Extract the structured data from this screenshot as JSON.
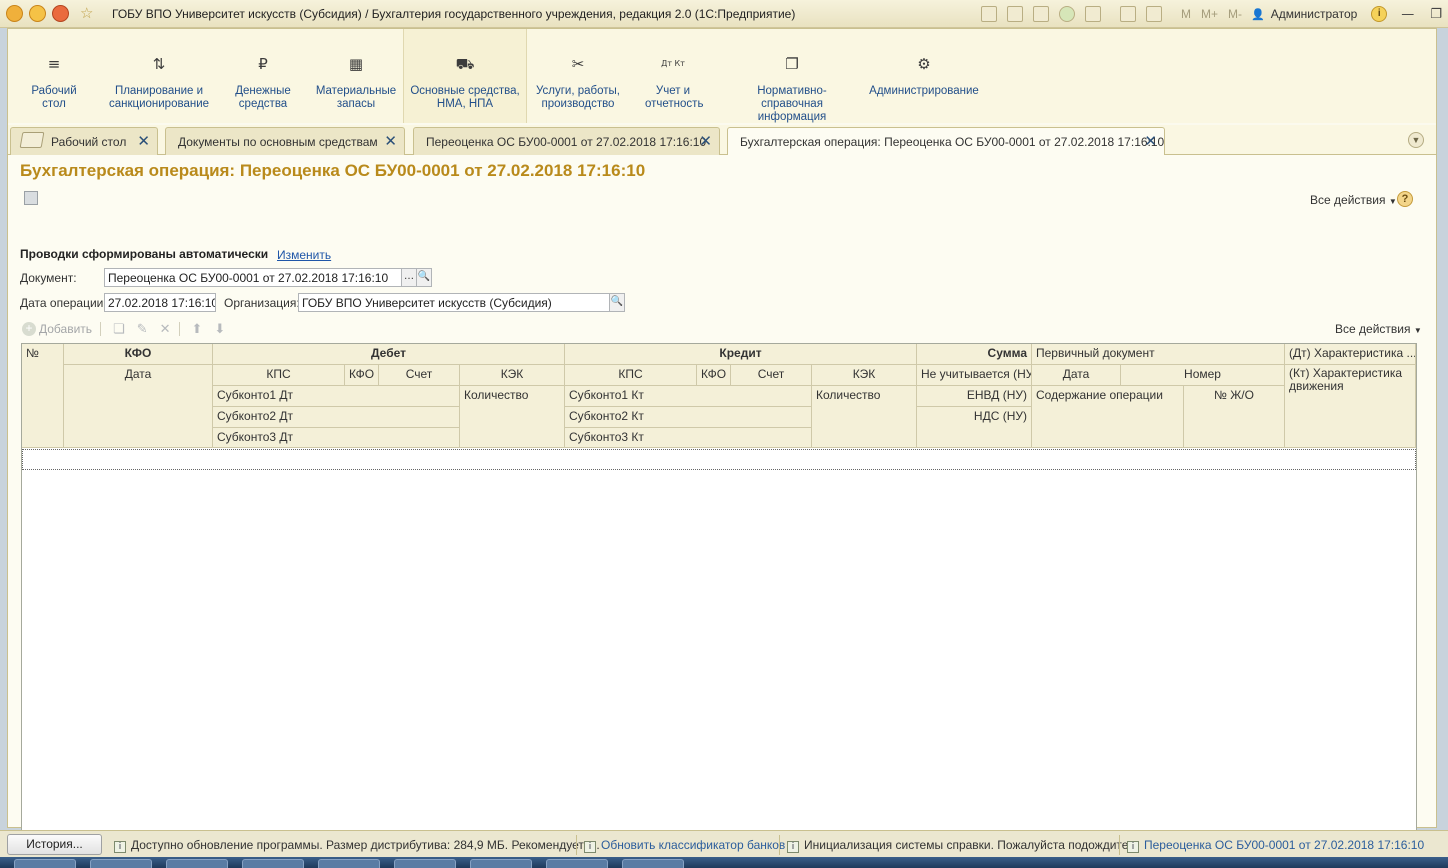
{
  "window": {
    "title": "ГОБУ ВПО Университет искусств (Субсидия) / Бухгалтерия государственного учреждения, редакция 2.0  (1С:Предприятие)",
    "m_buttons": [
      "M",
      "M+",
      "M-"
    ],
    "user": "Администратор"
  },
  "sections": [
    {
      "label": "Рабочий стол",
      "icon": "≡"
    },
    {
      "label": "Планирование и санкционирование",
      "icon": "⇅"
    },
    {
      "label": "Денежные средства",
      "icon": "₽"
    },
    {
      "label": "Материальные запасы",
      "icon": "▦"
    },
    {
      "label": "Основные средства, НМА, НПА",
      "icon": "⛟"
    },
    {
      "label": "Услуги, работы, производство",
      "icon": "✂"
    },
    {
      "label": "Учет и отчетность",
      "icon": "Дт Кт"
    },
    {
      "label": "Нормативно-справочная информация",
      "icon": "❐"
    },
    {
      "label": "Администрирование",
      "icon": "⚙"
    }
  ],
  "tabs": [
    {
      "label": "Рабочий стол"
    },
    {
      "label": "Документы по основным средствам"
    },
    {
      "label": "Переоценка ОС БУ00-0001 от 27.02.2018 17:16:10"
    },
    {
      "label": "Бухгалтерская операция: Переоценка ОС БУ00-0001 от 27.02.2018 17:16:10"
    }
  ],
  "form": {
    "title": "Бухгалтерская операция: Переоценка ОС БУ00-0001 от 27.02.2018 17:16:10",
    "all_actions": "Все действия",
    "help": "?",
    "auto_label": "Проводки сформированы автоматически",
    "change_link": "Изменить",
    "document_label": "Документ:",
    "document_value": "Переоценка ОС БУ00-0001 от 27.02.2018 17:16:10",
    "date_label": "Дата операции:",
    "date_value": "27.02.2018 17:16:10",
    "org_label": "Организация:",
    "org_value": "ГОБУ ВПО Университет искусств (Субсидия)"
  },
  "table_toolbar": {
    "add": "Добавить",
    "all_actions": "Все действия"
  },
  "grid": {
    "header": {
      "num": "№",
      "kfo": "КФО",
      "date": "Дата",
      "debit": "Дебет",
      "credit": "Кредит",
      "sum": "Сумма",
      "primary_doc": "Первичный документ",
      "char_dt": "(Дт) Характеристика ...",
      "char_kt": "(Кт) Характеристика движения",
      "kps": "КПС",
      "kfo_sub": "КФО",
      "account": "Счет",
      "kek": "КЭК",
      "subkonto1_dt": "Субконто1 Дт",
      "subkonto2_dt": "Субконто2 Дт",
      "subkonto3_dt": "Субконто3 Дт",
      "subkonto1_kt": "Субконто1 Кт",
      "subkonto2_kt": "Субконто2 Кт",
      "subkonto3_kt": "Субконто3 Кт",
      "quantity": "Количество",
      "not_counted": "Не учитывается (НУ)",
      "envd": "ЕНВД (НУ)",
      "nds": "НДС (НУ)",
      "pd_date": "Дата",
      "pd_number": "Номер",
      "content": "Содержание операции",
      "jo_num": "№ Ж/О"
    }
  },
  "statusbar": {
    "history": "История...",
    "notices": [
      {
        "text": "Доступно обновление программы. Размер дистрибутива: 284,9 МБ. Рекомендуетс..."
      },
      {
        "text": "Обновить классификатор банков"
      },
      {
        "text": "Инициализация системы справки. Пожалуйста подождите..."
      },
      {
        "text": "Переоценка ОС БУ00-0001 от 27.02.2018 17:16:10"
      }
    ]
  }
}
